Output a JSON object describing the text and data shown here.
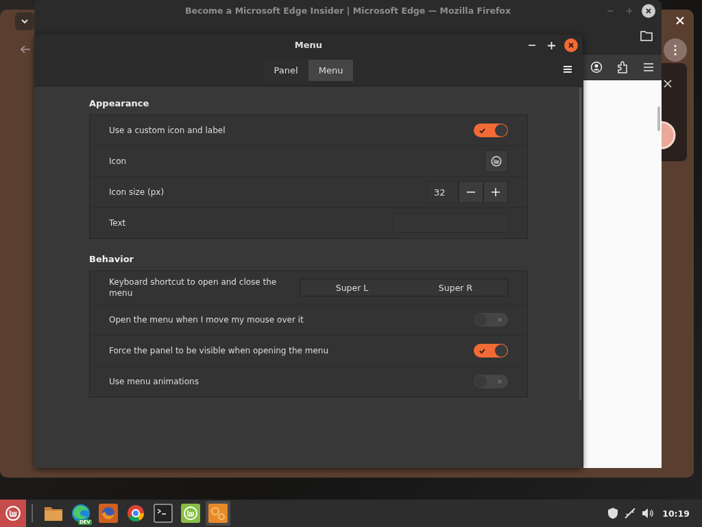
{
  "background_window": {
    "title": "Become a Microsoft Edge Insider | Microsoft Edge — Mozilla Firefox"
  },
  "dialog": {
    "title": "Menu",
    "tabs": [
      {
        "label": "Panel",
        "selected": false
      },
      {
        "label": "Menu",
        "selected": true
      }
    ],
    "sections": [
      {
        "title": "Appearance",
        "rows": [
          {
            "kind": "switch",
            "label": "Use a custom icon and label",
            "on": true
          },
          {
            "kind": "icon",
            "label": "Icon"
          },
          {
            "kind": "spin",
            "label": "Icon size (px)",
            "value": "32"
          },
          {
            "kind": "entry",
            "label": "Text"
          }
        ]
      },
      {
        "title": "Behavior",
        "rows": [
          {
            "kind": "keys",
            "label": "Keyboard shortcut to open and close the menu",
            "keys": [
              "Super L",
              "Super R"
            ]
          },
          {
            "kind": "switch",
            "label": "Open the menu when I move my mouse over it",
            "on": false
          },
          {
            "kind": "switch",
            "label": "Force the panel to be visible when opening the menu",
            "on": true
          },
          {
            "kind": "switch",
            "label": "Use menu animations",
            "on": false
          }
        ]
      }
    ]
  },
  "taskbar": {
    "apps": [
      {
        "kind": "files",
        "selected": false
      },
      {
        "kind": "edge",
        "badge": "DEV",
        "selected": false
      },
      {
        "kind": "firefox",
        "selected": false
      },
      {
        "kind": "chrome",
        "selected": false
      },
      {
        "kind": "terminal",
        "selected": false
      },
      {
        "kind": "mint",
        "selected": false
      },
      {
        "kind": "settings",
        "selected": true
      }
    ],
    "clock": "10:19"
  }
}
